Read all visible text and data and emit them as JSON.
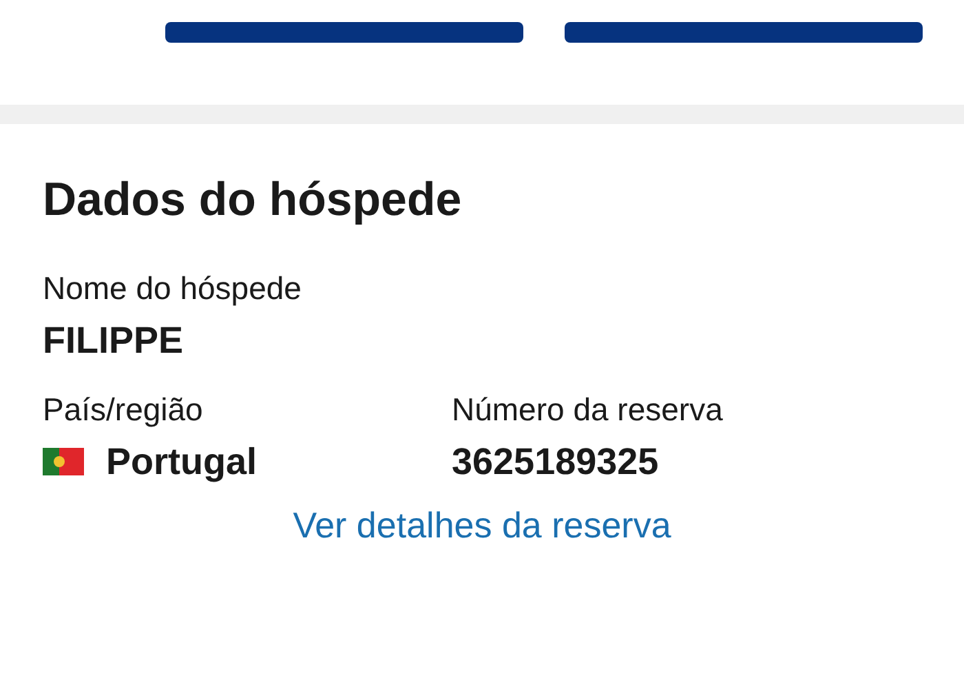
{
  "section": {
    "title": "Dados do hóspede"
  },
  "fields": [
    {
      "label": "Nome do hóspede",
      "value": "FILIPPE",
      "kind": "text"
    },
    {
      "label": "País/região",
      "value": "Portugal",
      "kind": "country"
    },
    {
      "label": "Número da reserva",
      "value": "3625189325",
      "kind": "text"
    }
  ],
  "link": "Ver detalhes da reserva"
}
